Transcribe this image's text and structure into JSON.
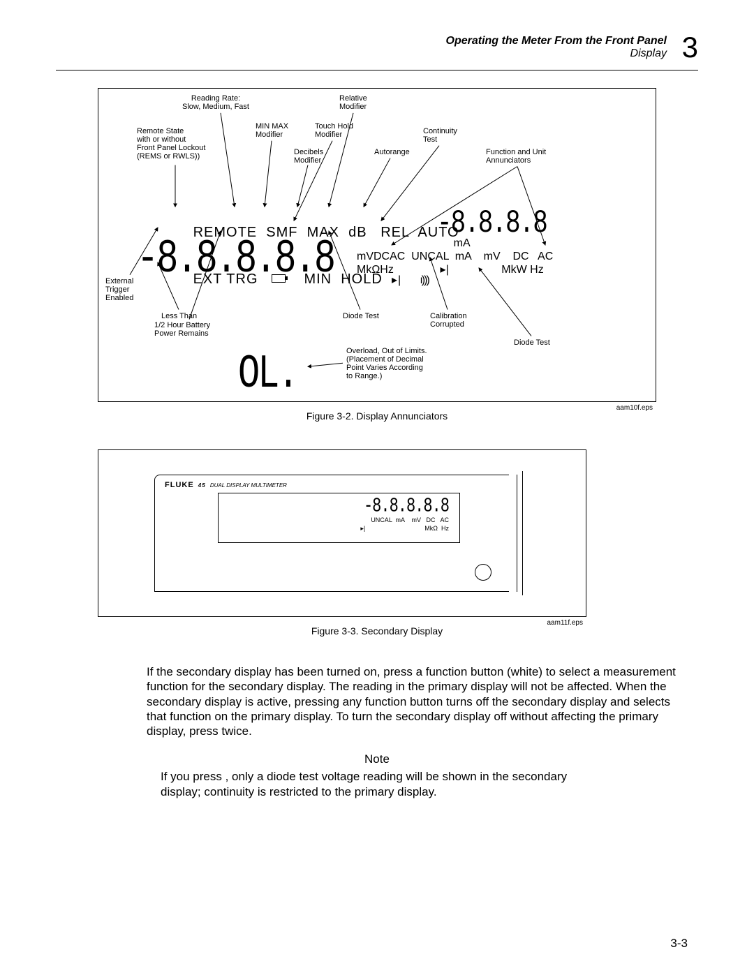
{
  "header": {
    "title": "Operating the Meter From the Front Panel",
    "subtitle": "Display",
    "chapter": "3"
  },
  "fig1": {
    "eps": "aam10f.eps",
    "caption": "Figure 3-2. Display Annunciators",
    "labels": {
      "readingRate": "Reading Rate:\nSlow, Medium, Fast",
      "relModifier": "Relative\nModifier",
      "remoteState": "Remote State\nwith or without\nFront Panel Lockout\n(REMS or RWLS))",
      "minmax": "MIN MAX\nModifier",
      "touchHold": "Touch Hold\nModifier",
      "decibels": "Decibels\nModifier",
      "autorange": "Autorange",
      "continuity": "Continuity\nTest",
      "funcUnit": "Function and Unit\nAnnunciators",
      "extTrig": "External\nTrigger\nEnabled",
      "lessThan": "Less Than",
      "battery": "1/2 Hour Battery\nPower Remains",
      "diodeTest1": "Diode Test",
      "calCorrupt": "Calibration\nCorrupted",
      "diodeTest2": "Diode Test",
      "overload": "Overload, Out of Limits.\n(Placement of Decimal\nPoint Varies According\nto Range.)"
    },
    "annun": {
      "r1a": "REMOTE",
      "r1b": "SMF",
      "r1c": "MAX",
      "r1d": "dB",
      "r1e": "REL",
      "r1f": "AUTO",
      "r2a": "EXT TRG",
      "r2b": "MIN",
      "r2c": "HOLD",
      "unitsTop": "mA",
      "unitsMid": "mVDCAC",
      "unitsMid2": "UNCAL",
      "unitsMid3": "mA",
      "unitsMid4": "mV",
      "unitsMid5": "DC",
      "unitsMid6": "AC",
      "unitsBot": "MkΩHz",
      "unitsBot2": "MkW Hz",
      "mainDigits": "-8.8.8.8.8",
      "secDigits": "-8.8.8.8",
      "olDigits": "OL."
    }
  },
  "fig2": {
    "eps": "aam11f.eps",
    "caption": "Figure 3-3. Secondary Display",
    "brand": "FLUKE",
    "model": "45",
    "subtitle": "DUAL DISPLAY MULTIMETER",
    "secDigits": "-8.8.8.8.8",
    "unitLine1": "UNCAL  mA    mV   DC   AC",
    "unitLine2": "MkΩ  Hz"
  },
  "bodyText": "If the secondary display has been turned on, press a function button (white) to select a measurement function for the secondary display. The reading in the primary display will not be affected. When the secondary display is active, pressing any function button turns off the secondary display and selects that function on the primary display. To turn the secondary display off without affecting the primary display, press  twice.",
  "noteHeader": "Note",
  "noteBody": "If you press      , only a diode test voltage reading will be shown in the secondary display; continuity is restricted to the primary display.",
  "pageNumber": "3-3"
}
